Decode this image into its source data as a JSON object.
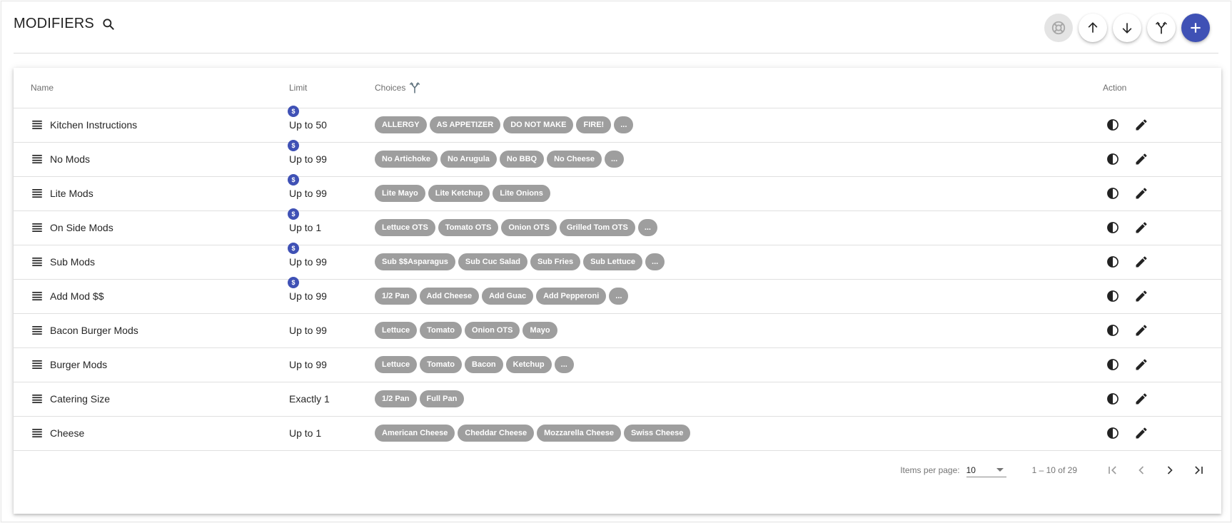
{
  "header": {
    "title": "MODIFIERS"
  },
  "toolbar": {
    "buttons": [
      "lifebuoy-icon",
      "arrow-up-icon",
      "arrow-down-icon",
      "merge-icon",
      "add-icon"
    ],
    "accent": "#3f51b5"
  },
  "table": {
    "columns": {
      "name": "Name",
      "limit": "Limit",
      "choices": "Choices",
      "action": "Action"
    },
    "rows": [
      {
        "name": "Kitchen Instructions",
        "limit": "Up to 50",
        "priced": true,
        "choices": [
          "ALLERGY",
          "AS APPETIZER",
          "DO NOT MAKE",
          "FIRE!",
          "..."
        ]
      },
      {
        "name": "No Mods",
        "limit": "Up to 99",
        "priced": true,
        "choices": [
          "No Artichoke",
          "No Arugula",
          "No BBQ",
          "No Cheese",
          "..."
        ]
      },
      {
        "name": "Lite Mods",
        "limit": "Up to 99",
        "priced": true,
        "choices": [
          "Lite Mayo",
          "Lite Ketchup",
          "Lite Onions"
        ]
      },
      {
        "name": "On Side Mods",
        "limit": "Up to 1",
        "priced": true,
        "choices": [
          "Lettuce OTS",
          "Tomato OTS",
          "Onion OTS",
          "Grilled Tom OTS",
          "..."
        ]
      },
      {
        "name": "Sub Mods",
        "limit": "Up to 99",
        "priced": true,
        "choices": [
          "Sub $$Asparagus",
          "Sub Cuc Salad",
          "Sub Fries",
          "Sub Lettuce",
          "..."
        ]
      },
      {
        "name": "Add Mod $$",
        "limit": "Up to 99",
        "priced": true,
        "choices": [
          "1/2 Pan",
          "Add Cheese",
          "Add Guac",
          "Add Pepperoni",
          "..."
        ]
      },
      {
        "name": "Bacon Burger Mods",
        "limit": "Up to 99",
        "priced": false,
        "choices": [
          "Lettuce",
          "Tomato",
          "Onion OTS",
          "Mayo"
        ]
      },
      {
        "name": "Burger Mods",
        "limit": "Up to 99",
        "priced": false,
        "choices": [
          "Lettuce",
          "Tomato",
          "Bacon",
          "Ketchup",
          "..."
        ]
      },
      {
        "name": "Catering Size",
        "limit": "Exactly 1",
        "priced": false,
        "choices": [
          "1/2 Pan",
          "Full Pan"
        ]
      },
      {
        "name": "Cheese",
        "limit": "Up to 1",
        "priced": false,
        "choices": [
          "American Cheese",
          "Cheddar Cheese",
          "Mozzarella Cheese",
          "Swiss Cheese"
        ]
      }
    ],
    "price_badge": "$"
  },
  "paginator": {
    "label": "Items per page:",
    "page_size": "10",
    "range": "1 – 10 of 29"
  }
}
